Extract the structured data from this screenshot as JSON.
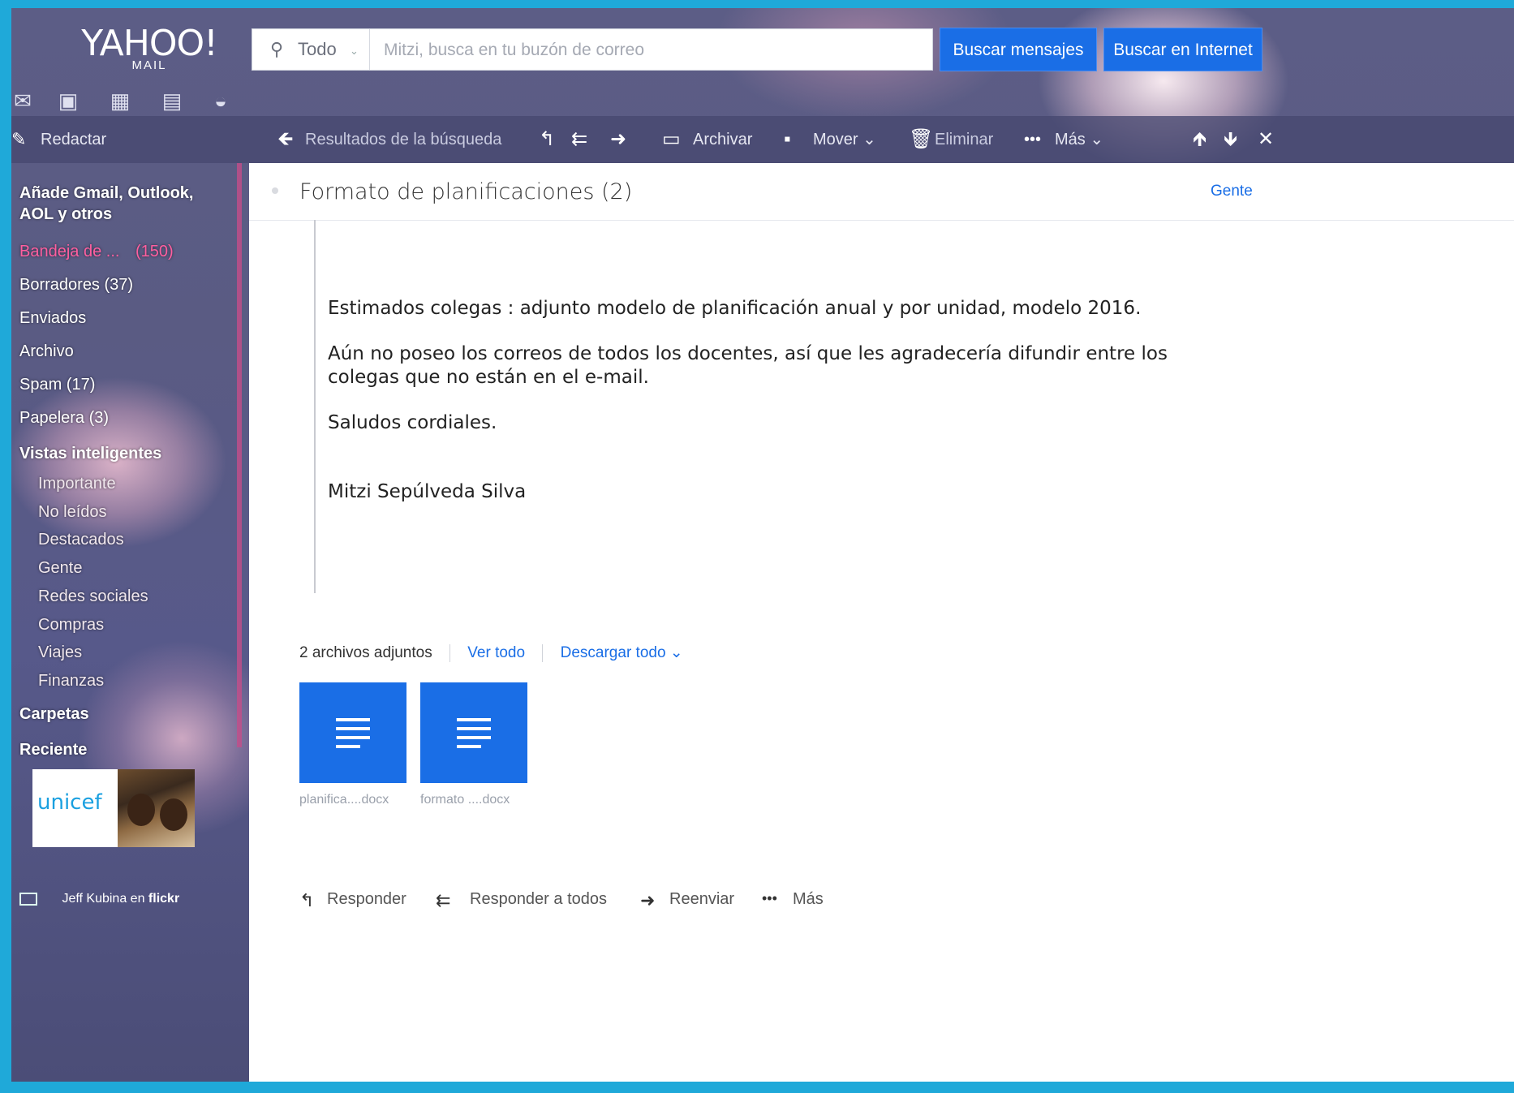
{
  "brand": {
    "logo": "YAHOO!",
    "sub": "MAIL"
  },
  "search": {
    "scope": "Todo",
    "placeholder": "Mitzi, busca en tu buzón de correo",
    "btn_mail": "Buscar mensajes",
    "btn_web": "Buscar en Internet"
  },
  "toolbar": {
    "compose": "Redactar",
    "back": "Resultados de la búsqueda",
    "archive": "Archivar",
    "move": "Mover",
    "delete": "Eliminar",
    "more": "Más"
  },
  "sidebar": {
    "add_accounts": [
      "Añade Gmail, Outlook,",
      "AOL y otros"
    ],
    "folders": [
      {
        "label": "Bandeja de ...",
        "count": "(150)"
      },
      {
        "label": "Borradores (37)"
      },
      {
        "label": "Enviados"
      },
      {
        "label": "Archivo"
      },
      {
        "label": "Spam (17)"
      },
      {
        "label": "Papelera (3)"
      }
    ],
    "smart_views_title": "Vistas inteligentes",
    "smart_views": [
      "Importante",
      "No leídos",
      "Destacados",
      "Gente",
      "Redes sociales",
      "Compras",
      "Viajes",
      "Finanzas"
    ],
    "folders_title": "Carpetas",
    "recent_title": "Reciente",
    "ad_word": "unicef",
    "credit": "Jeff Kubina en",
    "credit_brand": "flickr"
  },
  "message": {
    "subject": "Formato de planificaciones (2)",
    "people_link": "Gente",
    "body": [
      "Estimados colegas : adjunto modelo de planificación anual y por unidad, modelo 2016.",
      "Aún no poseo los correos de todos los docentes, así que les agradecería difundir entre los",
      "colegas que no están en el e-mail.",
      "Saludos cordiales.",
      "Mitzi Sepúlveda Silva"
    ],
    "attachments_count": "2 archivos adjuntos",
    "view_all": "Ver todo",
    "download_all": "Descargar todo",
    "attachments": [
      "planifica....docx",
      "formato ....docx"
    ],
    "actions": {
      "reply": "Responder",
      "reply_all": "Responder a todos",
      "forward": "Reenviar",
      "more": "Más"
    }
  },
  "colors": {
    "accent": "#1a6ee6",
    "frame": "#1fa9d9",
    "unread": "#ff5fa0"
  }
}
